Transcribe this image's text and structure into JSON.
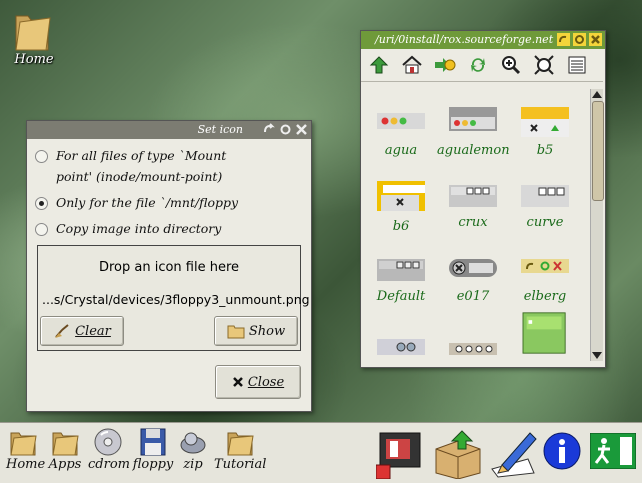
{
  "desktop": {
    "home_label": "Home"
  },
  "set_icon": {
    "title": "Set icon",
    "options": [
      {
        "label_line1": "For all files of type `Mount",
        "label_line2": "point' (inode/mount-point)",
        "selected": false
      },
      {
        "label_line1": "Only for the file `/mnt/floppy",
        "selected": true
      },
      {
        "label_line1": "Copy image into directory",
        "selected": false
      }
    ],
    "drop_text": "Drop an icon file here",
    "path_text": "...s/Crystal/devices/3floppy3_unmount.png",
    "clear_label": "Clear",
    "show_label": "Show",
    "close_label": "Close"
  },
  "filer": {
    "title": "/uri/0install/rox.sourceforge.net",
    "toolbar_icons": [
      "up-icon",
      "home-icon",
      "go-icon",
      "refresh-icon",
      "zoom-in-icon",
      "zoom-fit-icon",
      "details-icon"
    ],
    "items": [
      {
        "label": "agua"
      },
      {
        "label": "agualemon"
      },
      {
        "label": "b5"
      },
      {
        "label": "b6"
      },
      {
        "label": "crux"
      },
      {
        "label": "curve"
      },
      {
        "label": "Default"
      },
      {
        "label": "e017"
      },
      {
        "label": "elberg"
      },
      {
        "label": ""
      },
      {
        "label": ""
      },
      {
        "label": ""
      }
    ]
  },
  "panel": {
    "items": [
      {
        "label": "Home",
        "icon": "folder-icon"
      },
      {
        "label": "Apps",
        "icon": "folder-icon"
      },
      {
        "label": "cdrom",
        "icon": "cdrom-icon"
      },
      {
        "label": "floppy",
        "icon": "floppy-icon"
      },
      {
        "label": "zip",
        "icon": "zip-icon"
      },
      {
        "label": "Tutorial",
        "icon": "folder-icon"
      }
    ],
    "right_icons": [
      "paint-icon",
      "archive-icon",
      "edit-icon",
      "info-icon",
      "exit-icon"
    ]
  }
}
